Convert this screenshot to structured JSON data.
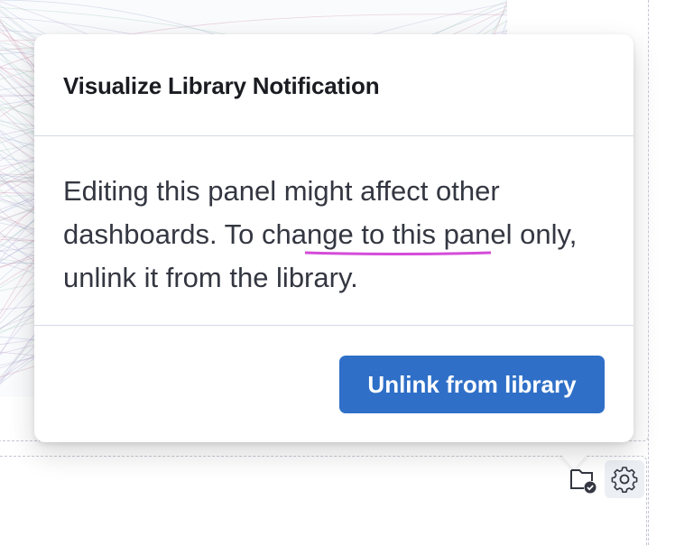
{
  "popover": {
    "title": "Visualize Library Notification",
    "body": "Editing this panel might affect other dashboards. To change to this panel only, unlink it from the library.",
    "unlink_button_label": "Unlink from library"
  },
  "panel_actions": {
    "icons": [
      "folder-check-icon",
      "gear-icon"
    ]
  },
  "colors": {
    "primary_button": "#2f6fc7",
    "spellcheck_underline": "#d44bd9",
    "chart_lines": [
      "#c98aa6",
      "#9ab0d2",
      "#9cc8b5",
      "#b3a0cf"
    ]
  }
}
